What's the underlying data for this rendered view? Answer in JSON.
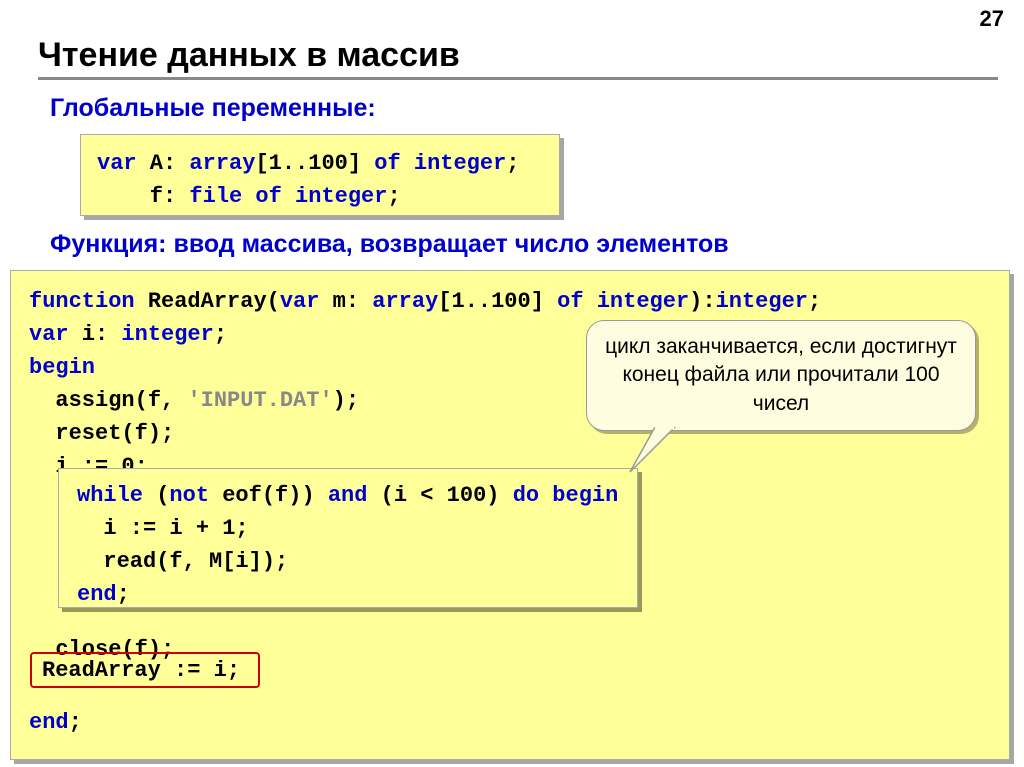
{
  "page_number": "27",
  "title": "Чтение данных в массив",
  "subtitle1": "Глобальные переменные:",
  "subtitle2": "Функция: ввод массива, возвращает число элементов",
  "box1": {
    "l1a": "var",
    "l1b": " A: ",
    "l1c": "array",
    "l1d": "[1..100] ",
    "l1e": "of integer",
    "l1f": ";",
    "l2a": "    f: ",
    "l2b": "file of integer",
    "l2c": ";"
  },
  "box2": {
    "l1a": "function",
    "l1b": " ReadArray(",
    "l1c": "var",
    "l1d": " m: ",
    "l1e": "array",
    "l1f": "[1..100] ",
    "l1g": "of integer",
    "l1h": "):",
    "l1i": "integer",
    "l1j": ";",
    "l2a": "var",
    "l2b": " i: ",
    "l2c": "integer",
    "l2d": ";",
    "l3": "begin",
    "l4a": "  assign(f, ",
    "l4b": "'INPUT.DAT'",
    "l4c": ");",
    "l5": "  reset(f);",
    "l6": "  i := 0;",
    "l7": "  close(f);",
    "l8": "end"
  },
  "box3": {
    "l1a": "while",
    "l1b": " (",
    "l1c": "not",
    "l1d": " eof(f)) ",
    "l1e": "and",
    "l1f": " (i < 100) ",
    "l1g": "do begin",
    "l2": "  i := i + 1;",
    "l3": "  read(f, M[i]);",
    "l4": "end"
  },
  "red_box": "ReadArray := i;",
  "callout": "цикл заканчивается, если достигнут конец файла или прочитали 100 чисел"
}
